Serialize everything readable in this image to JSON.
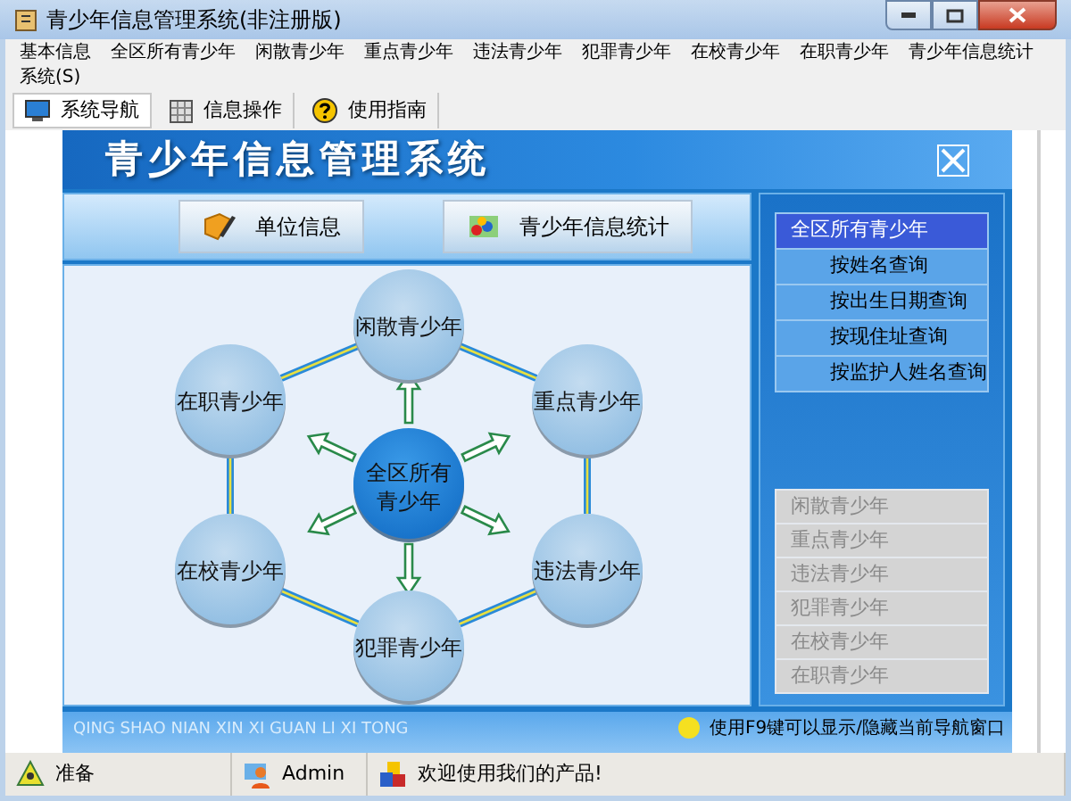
{
  "window": {
    "title": "青少年信息管理系统(非注册版)"
  },
  "menu": [
    "基本信息",
    "全区所有青少年",
    "闲散青少年",
    "重点青少年",
    "违法青少年",
    "犯罪青少年",
    "在校青少年",
    "在职青少年",
    "青少年信息统计",
    "系统(S)"
  ],
  "toolbar": [
    {
      "label": "系统导航",
      "selected": true,
      "kind": "monitor"
    },
    {
      "label": "信息操作",
      "selected": false,
      "kind": "grid"
    },
    {
      "label": "使用指南",
      "selected": false,
      "kind": "help"
    }
  ],
  "banner": {
    "title": "青少年信息管理系统"
  },
  "buttons": [
    {
      "label": "单位信息",
      "kind": "pencil"
    },
    {
      "label": "青少年信息统计",
      "kind": "chart"
    }
  ],
  "diagram": {
    "nodes": [
      {
        "label": "闲散青少年",
        "kind": "outer"
      },
      {
        "label": "在职青少年",
        "kind": "outer"
      },
      {
        "label": "重点青少年",
        "kind": "outer"
      },
      {
        "label": "全区所有青少年",
        "kind": "center"
      },
      {
        "label": "在校青少年",
        "kind": "outer"
      },
      {
        "label": "违法青少年",
        "kind": "outer"
      },
      {
        "label": "犯罪青少年",
        "kind": "outer"
      }
    ]
  },
  "nav": [
    {
      "label": "全区所有青少年",
      "selected": true
    },
    {
      "label": "按姓名查询",
      "selected": false
    },
    {
      "label": "按出生日期查询",
      "selected": false
    },
    {
      "label": "按现住址查询",
      "selected": false
    },
    {
      "label": "按监护人姓名查询",
      "selected": false
    }
  ],
  "categories": [
    {
      "label": "闲散青少年",
      "disabled": true
    },
    {
      "label": "重点青少年",
      "disabled": true
    },
    {
      "label": "违法青少年",
      "disabled": true
    },
    {
      "label": "犯罪青少年",
      "disabled": true
    },
    {
      "label": "在校青少年",
      "disabled": true
    },
    {
      "label": "在职青少年",
      "disabled": true
    }
  ],
  "footer": {
    "pinyin": "QING SHAO NIAN XIN XI GUAN LI XI TONG",
    "tip": "使用F9键可以显示/隐藏当前导航窗口"
  },
  "status_bar": [
    {
      "text": "准备",
      "kind": "ready"
    },
    {
      "text": "Admin",
      "kind": "user"
    },
    {
      "text": "欢迎使用我们的产品!",
      "kind": "product"
    }
  ]
}
